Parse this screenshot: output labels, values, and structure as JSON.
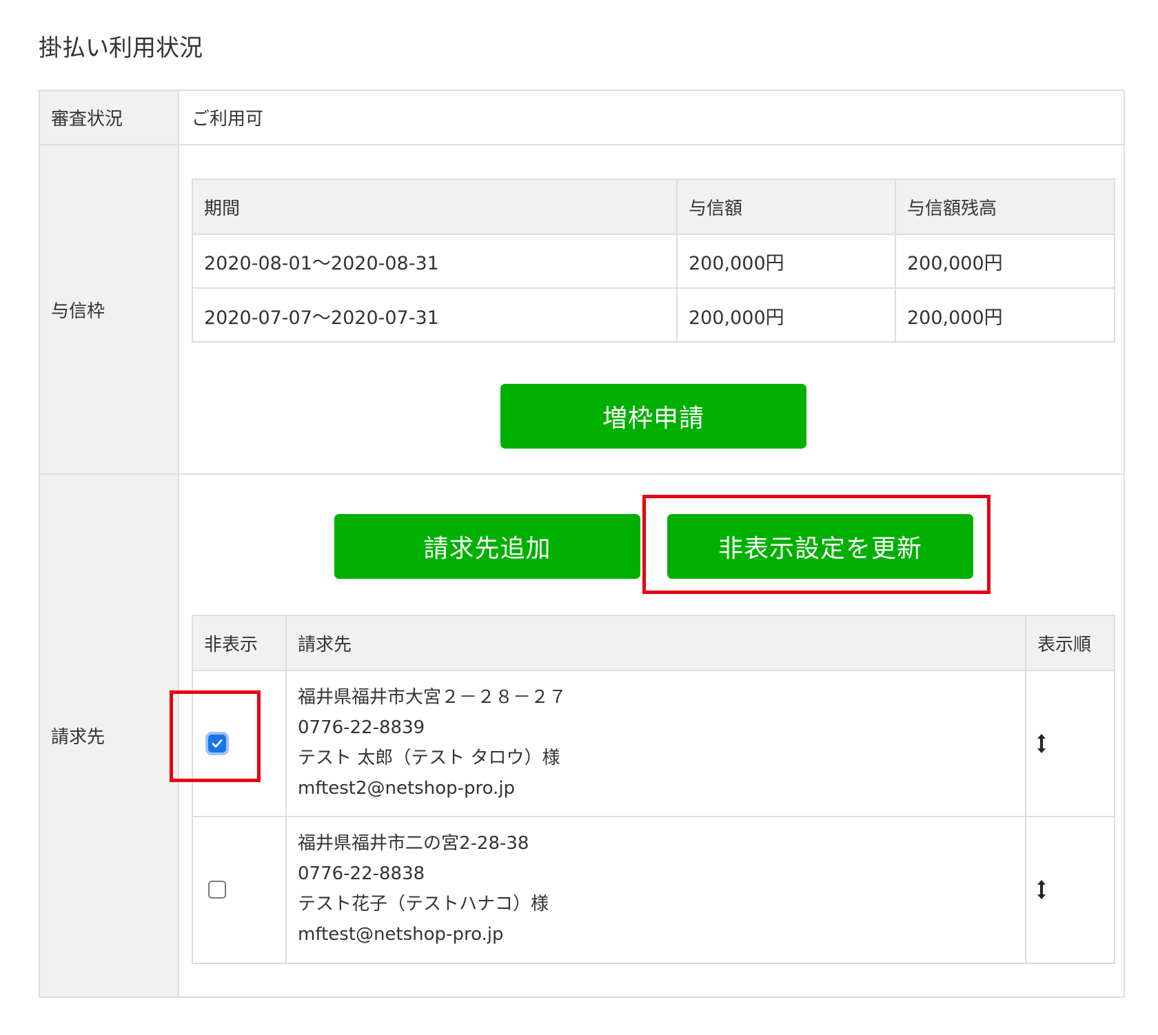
{
  "page_title": "掛払い利用状況",
  "rows": {
    "review": {
      "label": "審査状況",
      "value": "ご利用可"
    },
    "credit": {
      "label": "与信枠",
      "table": {
        "headers": [
          "期間",
          "与信額",
          "与信額残高"
        ],
        "rows": [
          [
            "2020-08-01〜2020-08-31",
            "200,000円",
            "200,000円"
          ],
          [
            "2020-07-07〜2020-07-31",
            "200,000円",
            "200,000円"
          ]
        ]
      },
      "increase_button": "増枠申請"
    },
    "billing": {
      "label": "請求先",
      "add_button": "請求先追加",
      "update_hidden_button": "非表示設定を更新",
      "table": {
        "headers": [
          "非表示",
          "請求先",
          "表示順"
        ],
        "rows": [
          {
            "hidden": true,
            "address": "福井県福井市大宮２－２８－２７",
            "phone": "0776-22-8839",
            "name": "テスト 太郎（テスト タロウ）様",
            "email": "mftest2@netshop-pro.jp"
          },
          {
            "hidden": false,
            "address": "福井県福井市二の宮2-28-38",
            "phone": "0776-22-8838",
            "name": "テスト花子（テストハナコ）様",
            "email": "mftest@netshop-pro.jp"
          }
        ]
      }
    }
  },
  "colors": {
    "button_green": "#00b000",
    "highlight_red": "#e60012",
    "header_bg": "#f1f1f1",
    "checkbox_blue": "#1a73e8"
  },
  "icons": {
    "sort_handle": "vertical-double-arrow-icon",
    "checkmark": "checkmark-icon"
  }
}
